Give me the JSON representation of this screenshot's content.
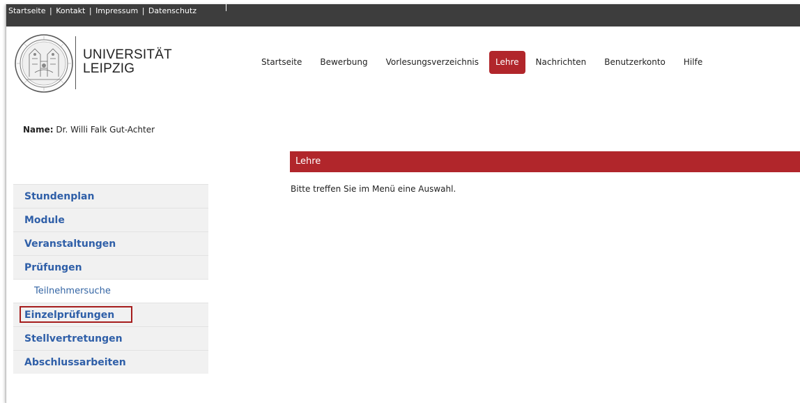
{
  "topbar": {
    "links": [
      "Startseite",
      "Kontakt",
      "Impressum",
      "Datenschutz"
    ],
    "separator": "|"
  },
  "logo": {
    "line1": "UNIVERSITÄT",
    "line2": "LEIPZIG",
    "seal_icon": "university-seal-icon"
  },
  "nav": {
    "items": [
      {
        "label": "Startseite"
      },
      {
        "label": "Bewerbung"
      },
      {
        "label": "Vorlesungsverzeichnis"
      },
      {
        "label": "Lehre"
      },
      {
        "label": "Nachrichten"
      },
      {
        "label": "Benutzerkonto"
      },
      {
        "label": "Hilfe"
      }
    ],
    "active": "Lehre"
  },
  "user": {
    "name_label": "Name:",
    "name_value": "Dr. Willi Falk Gut-Achter"
  },
  "sidebar": {
    "items": [
      {
        "label": "Stundenplan"
      },
      {
        "label": "Module"
      },
      {
        "label": "Veranstaltungen"
      },
      {
        "label": "Prüfungen"
      },
      {
        "label": "Teilnehmersuche"
      },
      {
        "label": "Einzelprüfungen"
      },
      {
        "label": "Stellvertretungen"
      },
      {
        "label": "Abschlussarbeiten"
      }
    ]
  },
  "main": {
    "title": "Lehre",
    "message": "Bitte treffen Sie im Menü eine Auswahl."
  },
  "colors": {
    "accent": "#b1262b",
    "link": "#2f5fa8",
    "topbar": "#3d3d3d",
    "highlight": "#a51c1c"
  }
}
